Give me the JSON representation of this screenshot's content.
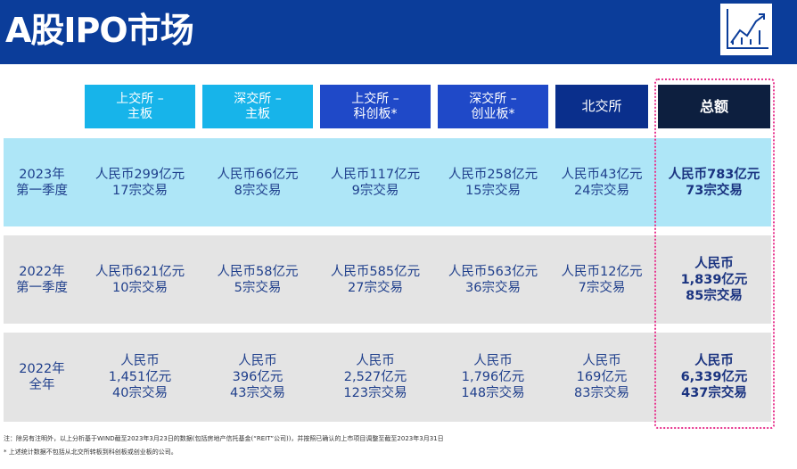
{
  "header": {
    "title": "A股IPO市场"
  },
  "icons": {
    "chart": "rising-chart-icon"
  },
  "colors": {
    "header_bg": "#0b3d9a",
    "head_light": "#17b4ea",
    "head_blue": "#1f49c8",
    "head_navy": "#0a2f8c",
    "head_total": "#0d1f3f",
    "row1_bg": "#aee6f7",
    "row_gray_bg": "#e4e4e4",
    "total_border": "#e8368f"
  },
  "columns": [
    {
      "label": "上交所 –\n主板"
    },
    {
      "label": "深交所 –\n主板"
    },
    {
      "label": "上交所 –\n科创板*"
    },
    {
      "label": "深交所 –\n创业板*"
    },
    {
      "label": "北交所"
    },
    {
      "label": "总额"
    }
  ],
  "rows": [
    {
      "label": "2023年\n第一季度",
      "cells": [
        "人民币299亿元\n17宗交易",
        "人民币66亿元\n8宗交易",
        "人民币117亿元\n9宗交易",
        "人民币258亿元\n15宗交易",
        "人民币43亿元\n24宗交易"
      ],
      "total": "人民币783亿元\n73宗交易"
    },
    {
      "label": "2022年\n第一季度",
      "cells": [
        "人民币621亿元\n10宗交易",
        "人民币58亿元\n5宗交易",
        "人民币585亿元\n27宗交易",
        "人民币563亿元\n36宗交易",
        "人民币12亿元\n7宗交易"
      ],
      "total": "人民币\n1,839亿元\n85宗交易"
    },
    {
      "label": "2022年\n全年",
      "cells": [
        "人民币\n1,451亿元\n40宗交易",
        "人民币\n396亿元\n43宗交易",
        "人民币\n2,527亿元\n123宗交易",
        "人民币\n1,796亿元\n148宗交易",
        "人民币\n169亿元\n83宗交易"
      ],
      "total": "人民币\n6,339亿元\n437宗交易"
    }
  ],
  "notes": [
    "注：除另有注明外，以上分析基于WIND截至2023年3月23日的数据(包括房地产信托基金(“REIT”公司))，并按照已确认的上市项目调整至截至2023年3月31日",
    "* 上述统计数据不包括从北交所转板到科创板或创业板的公司。"
  ]
}
